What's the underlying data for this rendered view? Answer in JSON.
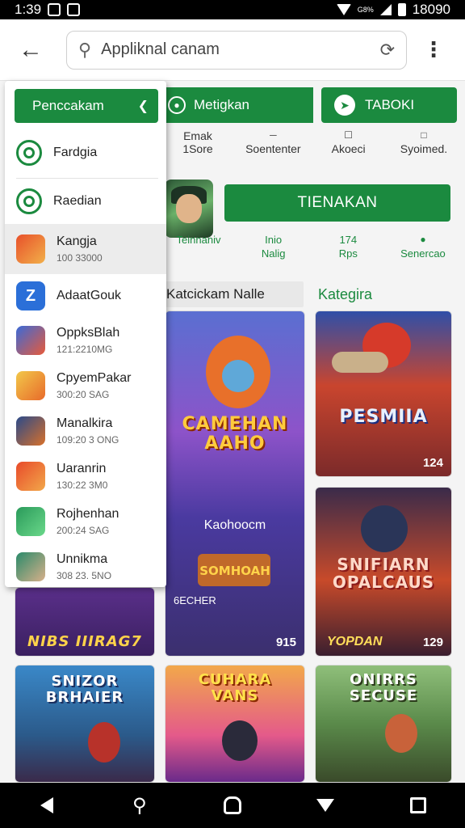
{
  "status_bar": {
    "time": "1:39",
    "network": "G8%",
    "right_time": "18090"
  },
  "search": {
    "value": "Appliknal canam",
    "placeholder": ""
  },
  "tabs": [
    {
      "label": "Penccakam"
    },
    {
      "label": "Metigkan"
    },
    {
      "label": "TABOKI"
    }
  ],
  "subcategories": [
    {
      "label": "Emak",
      "sub": "1Sore"
    },
    {
      "label": "Soententer",
      "sub": ""
    },
    {
      "label": "Akoeci",
      "sub": ""
    },
    {
      "label": "Syoimed.",
      "sub": ""
    }
  ],
  "install_button": "TIENAKAN",
  "stats": [
    {
      "line1": "",
      "line2": "Teinnaniv"
    },
    {
      "line1": "Inio",
      "line2": "Nalig"
    },
    {
      "line1": "174",
      "line2": "Rps"
    },
    {
      "line1": "",
      "line2": "Senercao"
    }
  ],
  "category_header": {
    "left": "Katcickam Nalle",
    "right": "Kategira"
  },
  "drawer": {
    "header": "Penccakam",
    "items": [
      {
        "name": "Fardgia",
        "meta": "",
        "icon": "circle-outline-icon"
      },
      {
        "name": "Raedian",
        "meta": "",
        "icon": "search-circle-icon"
      },
      {
        "name": "Kangja",
        "meta": "100 33000",
        "icon": "game-app-icon"
      },
      {
        "name": "AdaatGouk",
        "meta": "",
        "icon": "z-app-icon"
      },
      {
        "name": "OppksBlah",
        "meta": "121:2210MG",
        "icon": "game-app-icon"
      },
      {
        "name": "CpyemPakar",
        "meta": "300:20 SAG",
        "icon": "game-app-icon"
      },
      {
        "name": "Manalkira",
        "meta": "109:20 3 ONG",
        "icon": "game-app-icon"
      },
      {
        "name": "Uaranrin",
        "meta": "130:22 3M0",
        "icon": "game-app-icon"
      },
      {
        "name": "Rojhenhan",
        "meta": "200:24 SAG",
        "icon": "game-app-icon"
      },
      {
        "name": "Unnikma",
        "meta": "308 23. 5NO",
        "icon": "game-app-icon"
      }
    ]
  },
  "cards": [
    {
      "title": "CAMEHAN\nAAHO",
      "mid": "Kaohoocm",
      "lower": "SOMHOAH",
      "small": "6ECHER",
      "badge": "915"
    },
    {
      "title": "PESMIIA",
      "badge": "124"
    },
    {
      "title": "SNIFIARN\nOPALCAUS",
      "badge_left": "YOPDAN",
      "badge": "129"
    },
    {
      "title": "NIBS IIIRAG7",
      "mid": ""
    },
    {
      "title": "SNIZOR\nBRHAIER"
    },
    {
      "title": "CUHARA\nVANS"
    },
    {
      "title": "ONIRRS\nSECUSE"
    }
  ],
  "colors": {
    "accent": "#1b8a3f",
    "status_bar": "#000000",
    "nav_bar": "#000000"
  }
}
